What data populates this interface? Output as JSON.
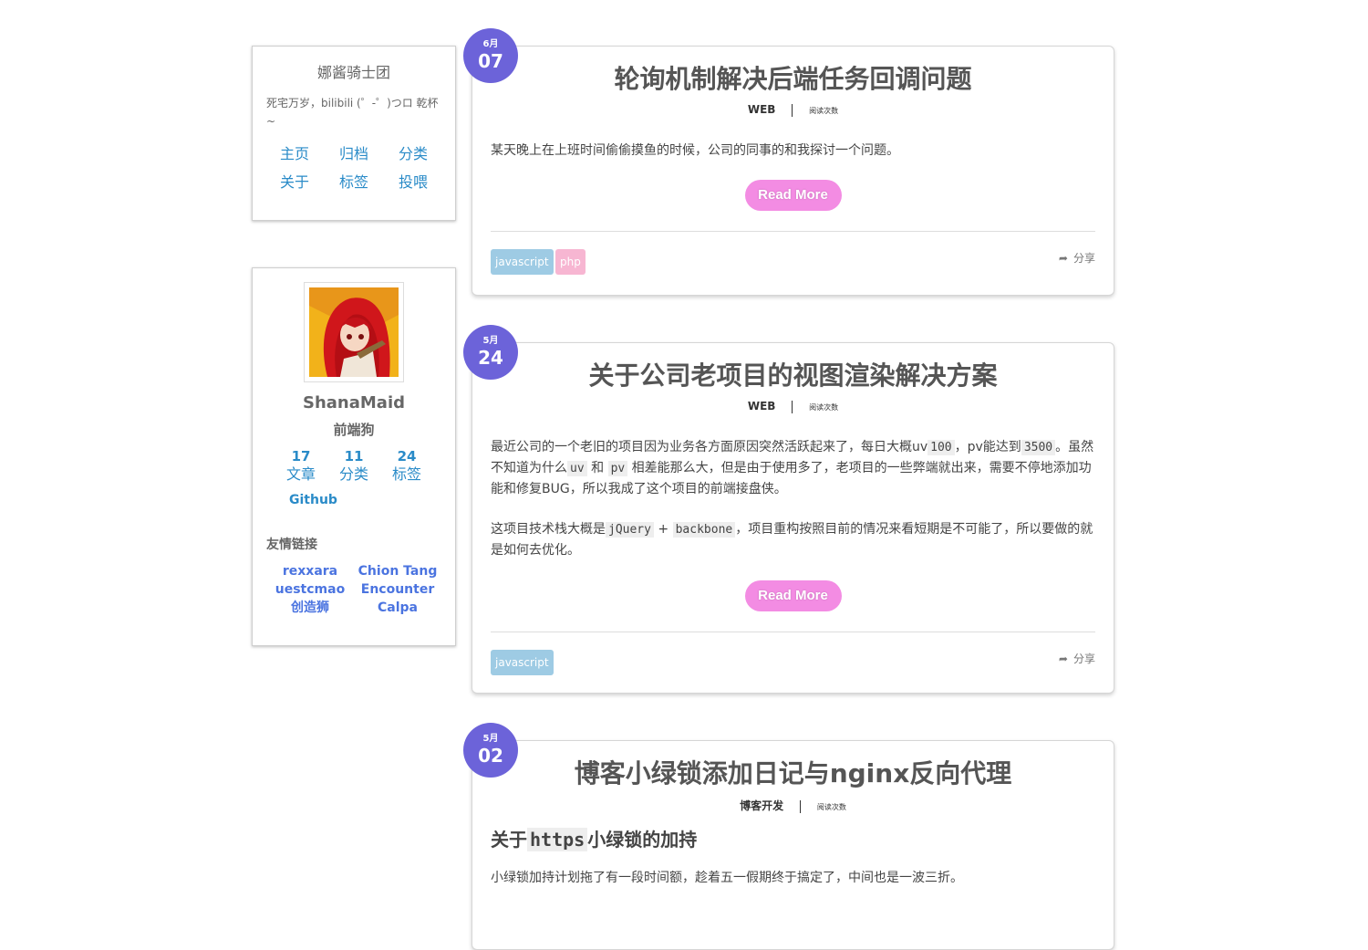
{
  "site": {
    "title": "娜酱骑士团",
    "description": "死宅万岁，bilibili (゜-゜)つロ 乾杯~",
    "menu": [
      "主页",
      "归档",
      "分类",
      "关于",
      "标签",
      "投喂"
    ]
  },
  "author": {
    "name": "ShanaMaid",
    "role": "前端狗",
    "stats": [
      {
        "num": "17",
        "label": "文章"
      },
      {
        "num": "11",
        "label": "分类"
      },
      {
        "num": "24",
        "label": "标签"
      }
    ],
    "github": "Github",
    "links_title": "友情链接",
    "links": [
      "rexxara",
      "Chion Tang",
      "uestcmao",
      "Encounter",
      "创造狮",
      "Calpa"
    ]
  },
  "posts": [
    {
      "month": "6月",
      "day": "07",
      "title": "轮询机制解决后端任务回调问题",
      "category": "WEB",
      "reads": "阅读次数",
      "excerpt": "某天晚上在上班时间偷偷摸鱼的时候，公司的同事的和我探讨一个问题。",
      "read_more": "Read More",
      "tags": [
        "javascript",
        "php"
      ],
      "share": "分享"
    },
    {
      "month": "5月",
      "day": "24",
      "title": "关于公司老项目的视图渲染解决方案",
      "category": "WEB",
      "reads": "阅读次数",
      "p1": {
        "a": "最近公司的一个老旧的项目因为业务各方面原因突然活跃起来了，每日大概uv",
        "code1": "100",
        "b": "，pv能达到",
        "code2": "3500",
        "c": "。虽然不知道为什么",
        "code3": "uv",
        "d": "和",
        "code4": "pv",
        "e": "相差能那么大，但是由于使用多了，老项目的一些弊端就出来，需要不停地添加功能和修复BUG，所以我成了这个项目的前端接盘侠。"
      },
      "p2": {
        "a": "这项目技术栈大概是",
        "code1": "jQuery",
        "b": "+",
        "code2": "backbone",
        "c": "，项目重构按照目前的情况来看短期是不可能了，所以要做的就是如何去优化。"
      },
      "read_more": "Read More",
      "tags": [
        "javascript"
      ],
      "share": "分享"
    },
    {
      "month": "5月",
      "day": "02",
      "title": "博客小绿锁添加日记与nginx反向代理",
      "category": "博客开发",
      "reads": "阅读次数",
      "heading": {
        "a": "关于",
        "code": "https",
        "b": "小绿锁的加持"
      },
      "excerpt": "小绿锁加持计划拖了有一段时间额，趁着五一假期终于搞定了，中间也是一波三折。"
    }
  ],
  "colors": {
    "badge": "#6c63d9",
    "read_more": "#f38ce3",
    "tag_javascript": "#9ecbe4",
    "tag_php": "#f7b6d2",
    "link_blue": "#2a8bc8"
  }
}
